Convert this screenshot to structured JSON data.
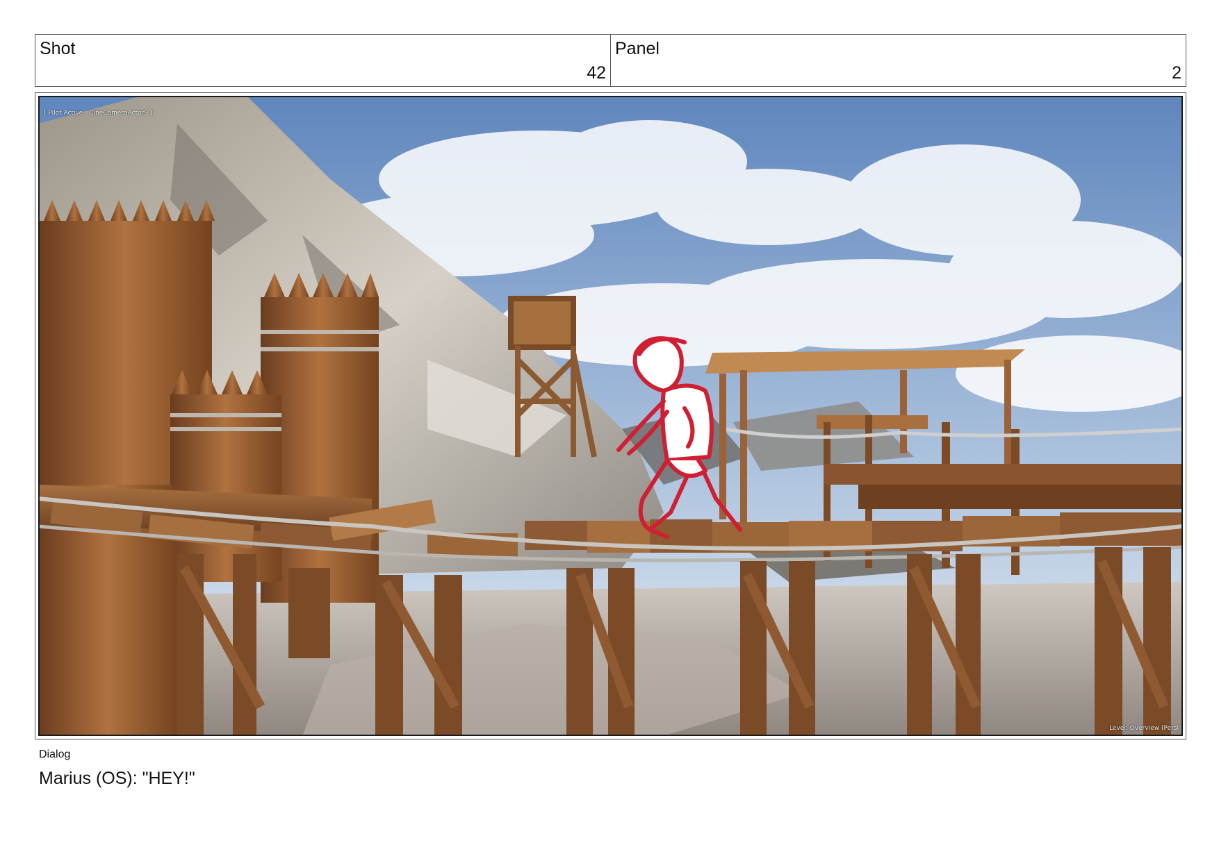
{
  "header": {
    "shot_label": "Shot",
    "shot_number": "42",
    "panel_label": "Panel",
    "panel_number": "2"
  },
  "viewport": {
    "pilot_text": "[ Pilot Active - CineCameraActor9 ]",
    "level_text": "Level:  Overview (Persi"
  },
  "dialog": {
    "label": "Dialog",
    "text": "Marius (OS): \"HEY!\""
  },
  "colors": {
    "sketch": "#d01e32",
    "sky": "#7093c4",
    "wood": "#8a5530",
    "rock": "#bfb7ad"
  }
}
